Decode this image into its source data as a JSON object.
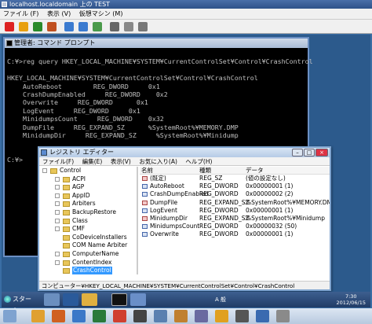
{
  "vm_window": {
    "title": "localhost.localdomain 上の TEST",
    "menu": [
      "ファイル (F)",
      "表示 (V)",
      "仮想マシン (M)"
    ]
  },
  "cmd_window": {
    "title": "管理者: コマンド プロンプト",
    "lines": [
      "",
      "C:¥>reg query HKEY_LOCAL_MACHINE¥SYSTEM¥CurrentControlSet¥Control¥CrashControl",
      "",
      "HKEY_LOCAL_MACHINE¥SYSTEM¥CurrentControlSet¥Control¥CrashControl",
      "    AutoReboot        REG_DWORD     0x1",
      "    CrashDumpEnabled     REG_DWORD    0x2",
      "    Overwrite     REG_DWORD      0x1",
      "    LogEvent     REG_DWORD     0x1",
      "    MinidumpsCount     REG_DWORD    0x32",
      "    DumpFile     REG_EXPAND_SZ      %SystemRoot%¥MEMORY.DMP",
      "    MinidumpDir     REG_EXPAND_SZ     %SystemRoot%¥Minidump",
      "",
      "",
      "C:¥>"
    ]
  },
  "regedit": {
    "title": "レジストリ エディター",
    "menu": [
      "ファイル(F)",
      "編集(E)",
      "表示(V)",
      "お気に入り(A)",
      "ヘルプ(H)"
    ],
    "tree": [
      {
        "label": "Control",
        "depth": 0,
        "expander": "-",
        "selected": false
      },
      {
        "label": "ACPI",
        "depth": 1,
        "expander": "+",
        "selected": false
      },
      {
        "label": "AGP",
        "depth": 1,
        "expander": "+",
        "selected": false
      },
      {
        "label": "AppID",
        "depth": 1,
        "expander": "+",
        "selected": false
      },
      {
        "label": "Arbiters",
        "depth": 1,
        "expander": "+",
        "selected": false
      },
      {
        "label": "BackupRestore",
        "depth": 1,
        "expander": "+",
        "selected": false
      },
      {
        "label": "Class",
        "depth": 1,
        "expander": "+",
        "selected": false
      },
      {
        "label": "CMF",
        "depth": 1,
        "expander": "+",
        "selected": false
      },
      {
        "label": "CoDeviceInstallers",
        "depth": 1,
        "expander": "",
        "selected": false
      },
      {
        "label": "COM Name Arbiter",
        "depth": 1,
        "expander": "",
        "selected": false
      },
      {
        "label": "ComputerName",
        "depth": 1,
        "expander": "+",
        "selected": false
      },
      {
        "label": "ContentIndex",
        "depth": 1,
        "expander": "+",
        "selected": false
      },
      {
        "label": "CrashControl",
        "depth": 1,
        "expander": "",
        "selected": true
      },
      {
        "label": "CriticalDeviceDatab",
        "depth": 1,
        "expander": "+",
        "selected": false
      }
    ],
    "columns": [
      "名前",
      "種類",
      "データ"
    ],
    "values": [
      {
        "name": "(既定)",
        "type": "REG_SZ",
        "data": "(値の設定なし)",
        "icon": "string"
      },
      {
        "name": "AutoReboot",
        "type": "REG_DWORD",
        "data": "0x00000001 (1)",
        "icon": "binary"
      },
      {
        "name": "CrashDumpEnabled",
        "type": "REG_DWORD",
        "data": "0x00000002 (2)",
        "icon": "binary"
      },
      {
        "name": "DumpFile",
        "type": "REG_EXPAND_SZ",
        "data": "%SystemRoot%¥MEMORY.DMP",
        "icon": "string"
      },
      {
        "name": "LogEvent",
        "type": "REG_DWORD",
        "data": "0x00000001 (1)",
        "icon": "binary"
      },
      {
        "name": "MinidumpDir",
        "type": "REG_EXPAND_SZ",
        "data": "%SystemRoot%¥Minidump",
        "icon": "string"
      },
      {
        "name": "MinidumpsCount",
        "type": "REG_DWORD",
        "data": "0x00000032 (50)",
        "icon": "binary"
      },
      {
        "name": "Overwrite",
        "type": "REG_DWORD",
        "data": "0x00000001 (1)",
        "icon": "binary"
      }
    ],
    "status": "コンピューター¥HKEY_LOCAL_MACHINE¥SYSTEM¥CurrentControlSet¥Control¥CrashControl"
  },
  "guest_taskbar": {
    "start_label": "スタート",
    "ime": "A 般",
    "time": "7:30",
    "date": "2012/06/15"
  }
}
